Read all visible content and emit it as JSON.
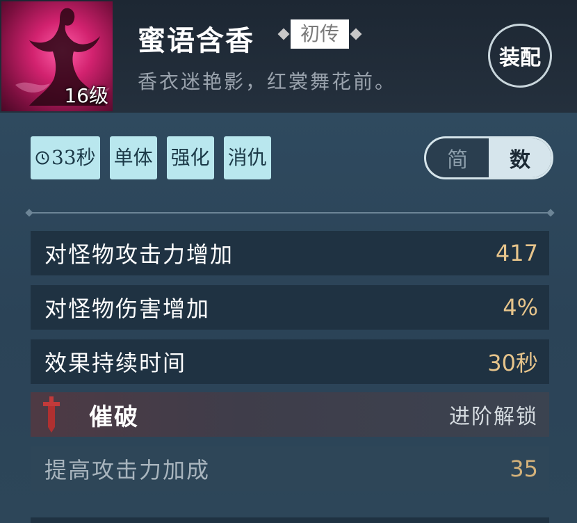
{
  "skill": {
    "name": "蜜语含香",
    "level": "16级",
    "rank": "初传",
    "description": "香衣迷艳影，红裳舞花前。",
    "equip_label": "装配"
  },
  "tags": [
    {
      "label": "33秒",
      "icon": "clock-icon"
    },
    {
      "label": "单体"
    },
    {
      "label": "强化"
    },
    {
      "label": "消仇"
    }
  ],
  "toggle": {
    "simple": "简",
    "numeric": "数",
    "selected": "数"
  },
  "stats": [
    {
      "label": "对怪物攻击力增加",
      "value": "417"
    },
    {
      "label": "对怪物伤害增加",
      "value": "4%"
    },
    {
      "label": "效果持续时间",
      "value": "30秒"
    }
  ],
  "breakthrough": {
    "icon": "sword-icon",
    "label": "催破",
    "status": "进阶解锁",
    "stats": [
      {
        "label": "提高攻击力加成",
        "value": "35"
      }
    ]
  },
  "colors": {
    "accent_tag": "#b9e7ee",
    "value_gold": "#e6c48b",
    "icon_pink": "#d2226f"
  }
}
